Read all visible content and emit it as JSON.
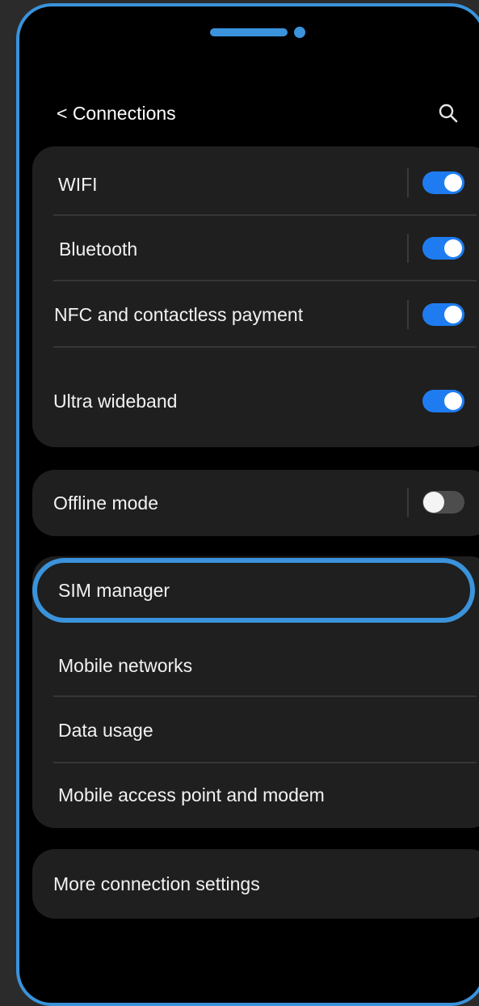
{
  "header": {
    "title": "< Connections",
    "search_icon": "search-icon"
  },
  "toggles_group": [
    {
      "label": "WIFI",
      "state": "on"
    },
    {
      "label": "Bluetooth",
      "state": "on"
    },
    {
      "label": "NFC and contactless payment",
      "state": "on"
    },
    {
      "label": "Ultra wideband",
      "state": "on"
    }
  ],
  "offline": {
    "label": "Offline mode",
    "state": "off"
  },
  "sim_group": [
    {
      "label": "SIM manager"
    },
    {
      "label": "Mobile networks"
    },
    {
      "label": "Data usage"
    },
    {
      "label": "Mobile access point and modem"
    }
  ],
  "more": {
    "label": "More connection settings"
  },
  "colors": {
    "accent": "#3a93db",
    "toggle_on": "#1e7cf0",
    "toggle_off": "#4d4d4d",
    "card": "#1f1f1f",
    "screen": "#000000"
  }
}
